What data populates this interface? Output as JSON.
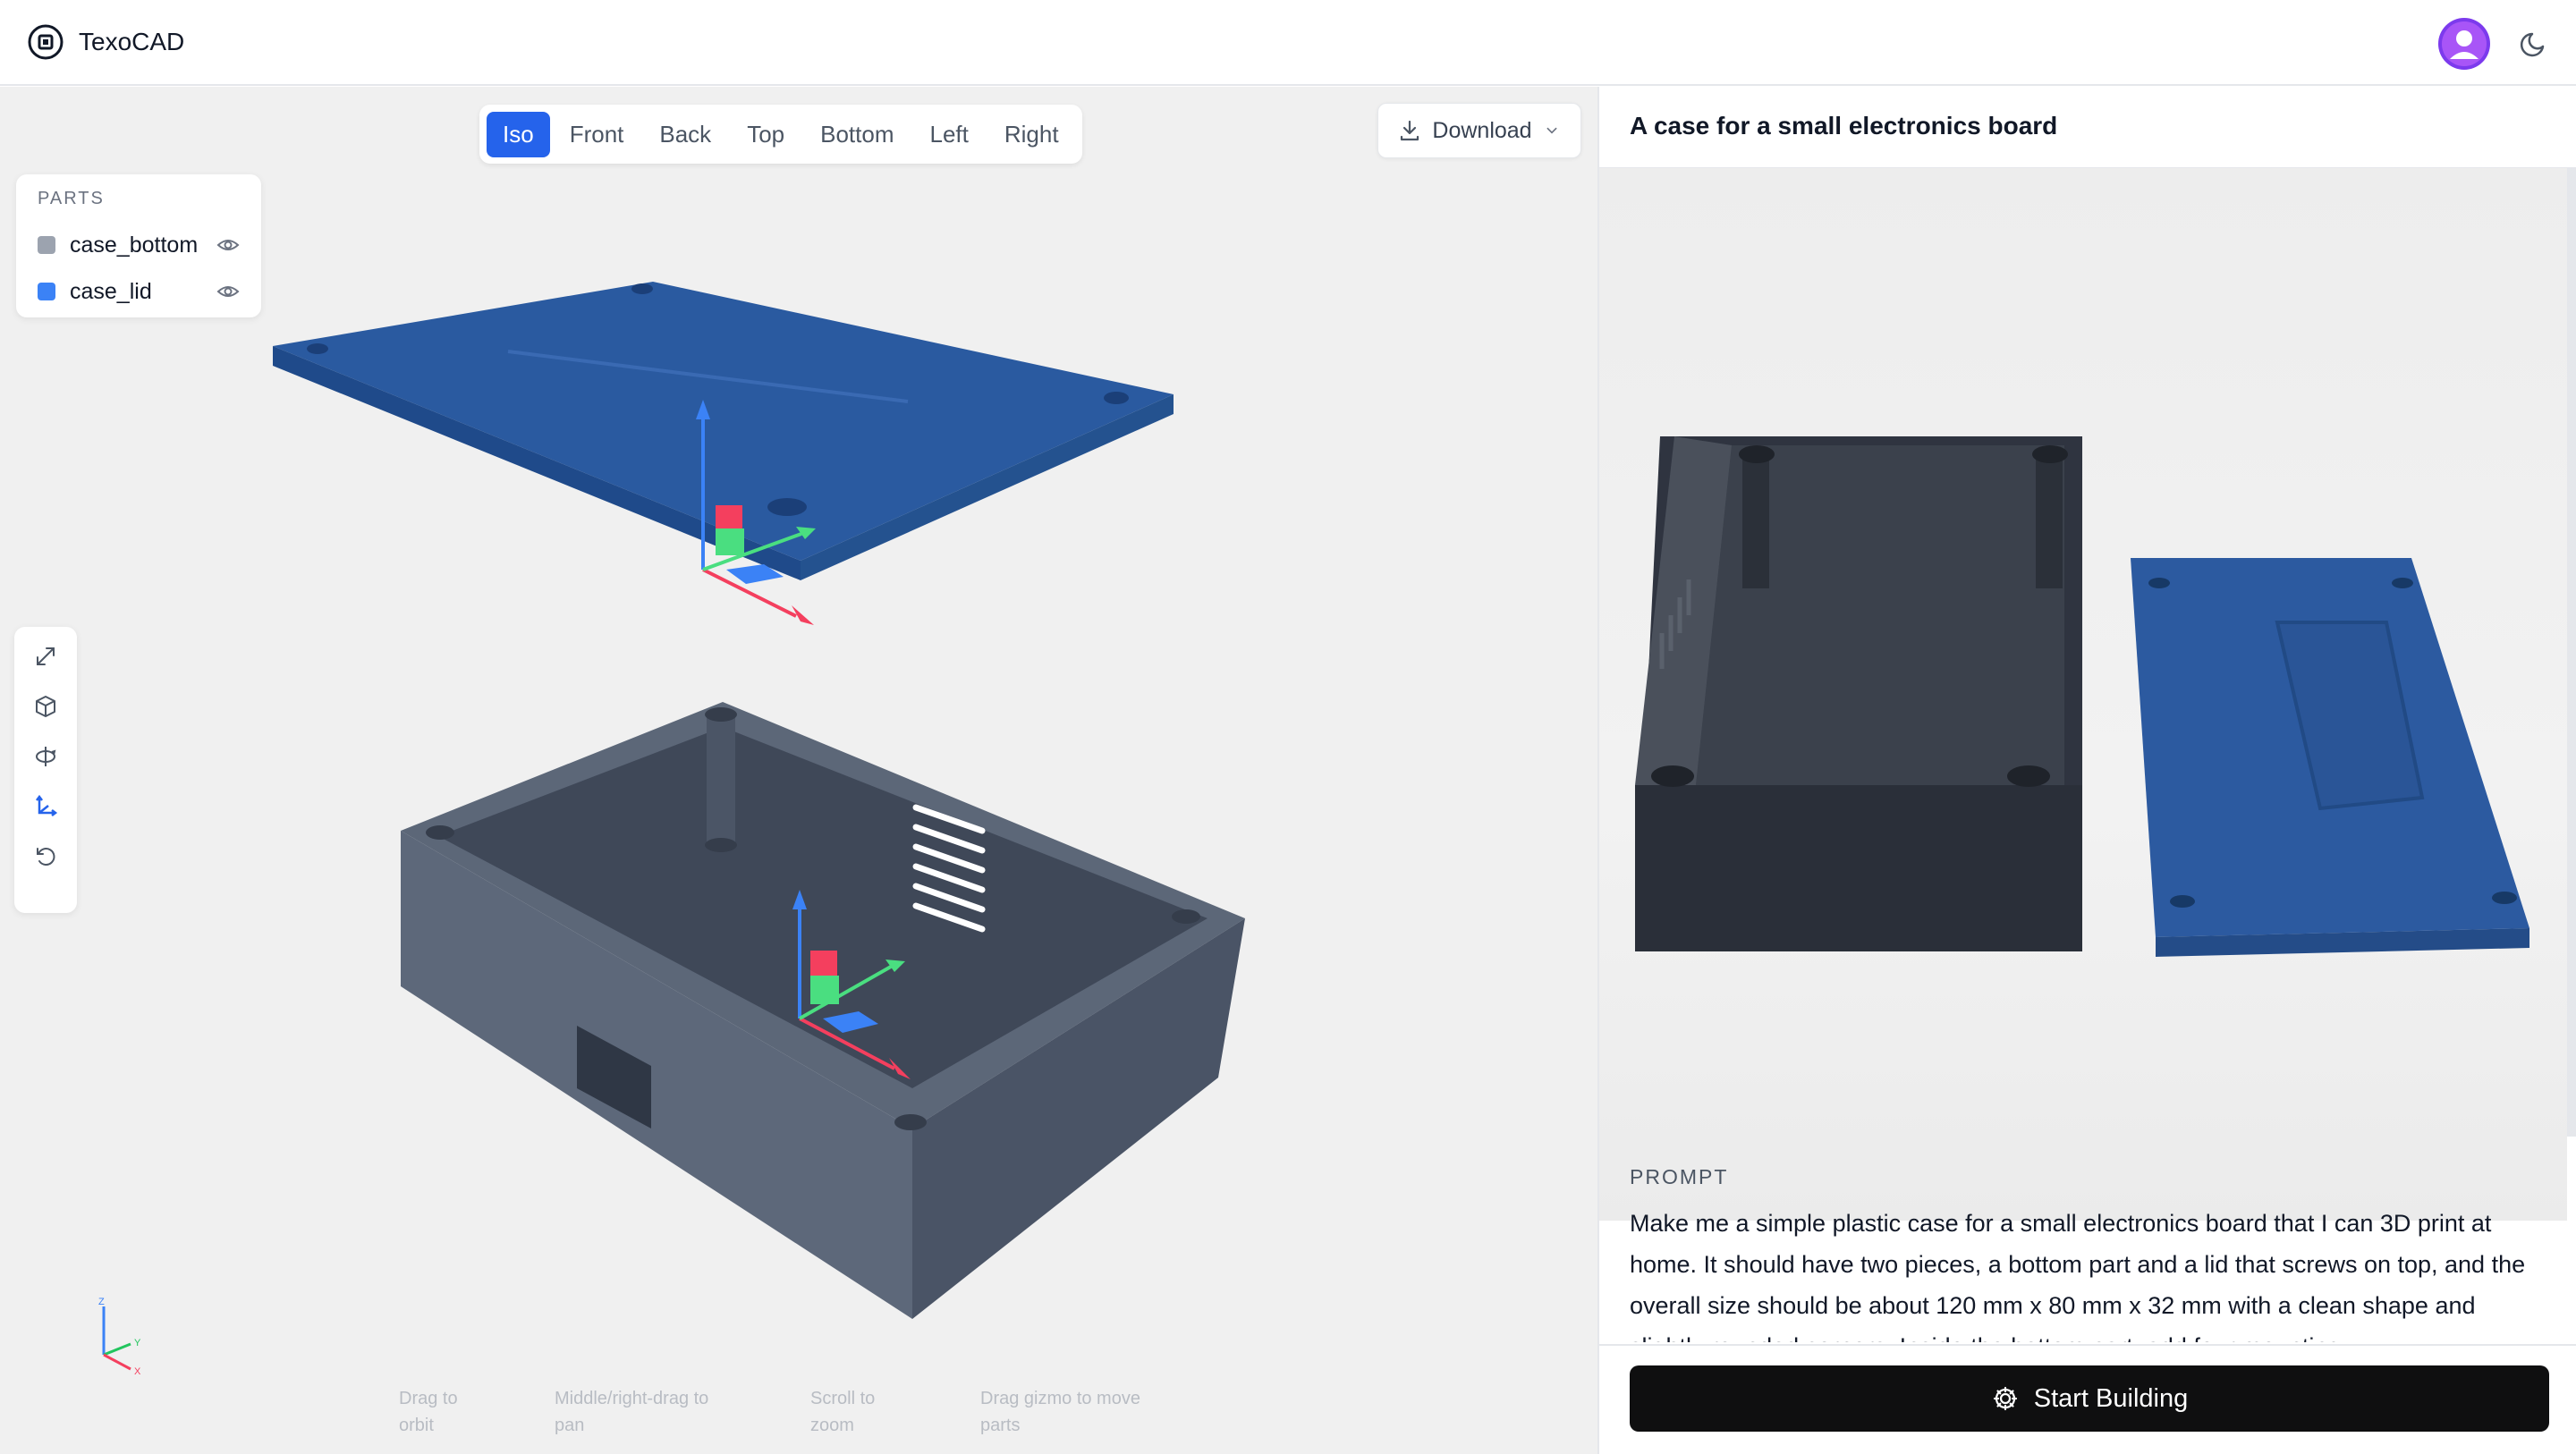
{
  "app": {
    "name": "TexoCAD"
  },
  "icons": {
    "logo": "chip-logo-icon",
    "avatar": "user-avatar-icon",
    "theme": "moon-icon",
    "download": "download-icon",
    "chevron": "chevron-down-icon",
    "eye": "eye-icon",
    "expand": "expand-icon",
    "cube": "cube-icon",
    "orbit": "orbit-icon",
    "axes": "axes-icon",
    "reset": "reset-icon",
    "start": "gear-icon"
  },
  "colors": {
    "accent": "#2563eb",
    "case_bottom": "#9ca3af",
    "case_lid": "#3b82f6",
    "avatar": "#7c3aed"
  },
  "viewport": {
    "view_tabs": [
      {
        "label": "Iso",
        "active": true
      },
      {
        "label": "Front",
        "active": false
      },
      {
        "label": "Back",
        "active": false
      },
      {
        "label": "Top",
        "active": false
      },
      {
        "label": "Bottom",
        "active": false
      },
      {
        "label": "Left",
        "active": false
      },
      {
        "label": "Right",
        "active": false
      }
    ],
    "download_label": "Download",
    "parts_title": "PARTS",
    "parts": [
      {
        "name": "case_bottom"
      },
      {
        "name": "case_lid"
      }
    ],
    "axis_labels": {
      "z": "Z",
      "y": "Y",
      "x": "X"
    },
    "hints": [
      {
        "l1": "Drag to",
        "l2": "orbit"
      },
      {
        "l1": "Middle/right-drag to",
        "l2": "pan"
      },
      {
        "l1": "Scroll to",
        "l2": "zoom"
      },
      {
        "l1": "Drag gizmo to move",
        "l2": "parts"
      }
    ]
  },
  "panel": {
    "title": "A case for a small electronics board",
    "prompt_label": "PROMPT",
    "prompt_text": "Make me a simple plastic case for a small electronics board that I can 3D print at home. It should have two pieces, a bottom part and a lid that screws on top, and the overall size should be about 120 mm x 80 mm x 32 mm with a clean shape and slightly rounded corners. Inside the bottom part, add four mounting",
    "start_label": "Start Building"
  }
}
